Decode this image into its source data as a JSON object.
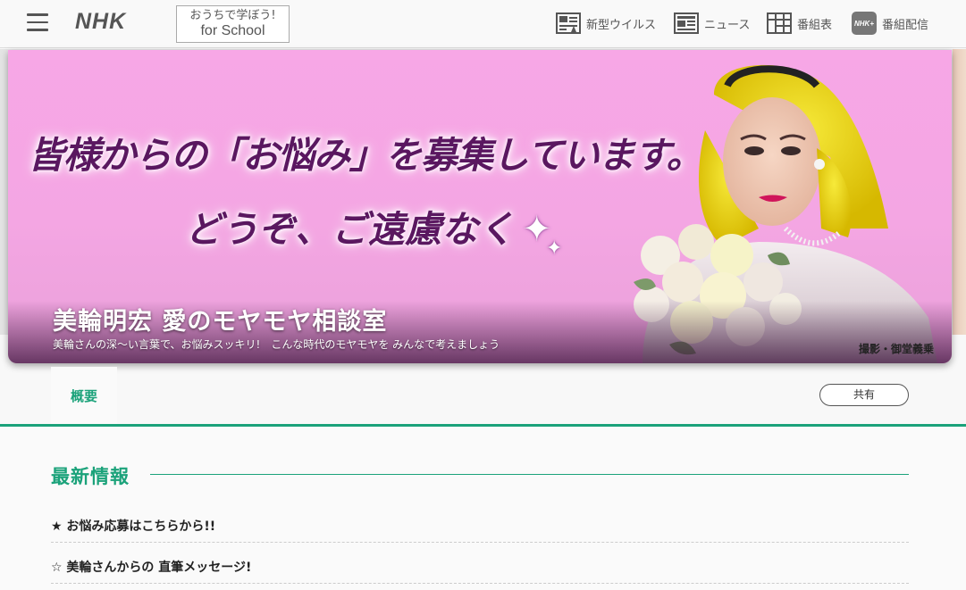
{
  "header": {
    "logo": "NHK",
    "school_line1": "おうちで学ぼう!",
    "school_line2": "for School",
    "nav": [
      {
        "label": "新型ウイルス",
        "icon": "news-screen-icon"
      },
      {
        "label": "ニュース",
        "icon": "newspaper-icon"
      },
      {
        "label": "番組表",
        "icon": "schedule-grid-icon"
      },
      {
        "label": "番組配信",
        "icon": "nhk-plus-icon"
      }
    ],
    "nhk_plus_badge": "NHK+"
  },
  "banner": {
    "headline_line1": "皆様からの「お悩み」を募集しています。",
    "headline_line2": "どうぞ、ご遠慮なく",
    "title": "美輪明宏 愛のモヤモヤ相談室",
    "subtitle": "美輪さんの深〜い言葉で、お悩みスッキリ!　こんな時代のモヤモヤを みんなで考えましょう",
    "credit": "撮影・御堂義乗"
  },
  "tabs": {
    "overview": "概要",
    "share": "共有"
  },
  "latest": {
    "title": "最新情報",
    "items": [
      {
        "label": "★ お悩み応募はこちらから!!"
      },
      {
        "label": "☆ 美輪さんからの 直筆メッセージ!"
      }
    ]
  },
  "colors": {
    "accent": "#1ba27a",
    "banner_pink": "#f4a6e3",
    "headline_purple": "#5a1760"
  }
}
